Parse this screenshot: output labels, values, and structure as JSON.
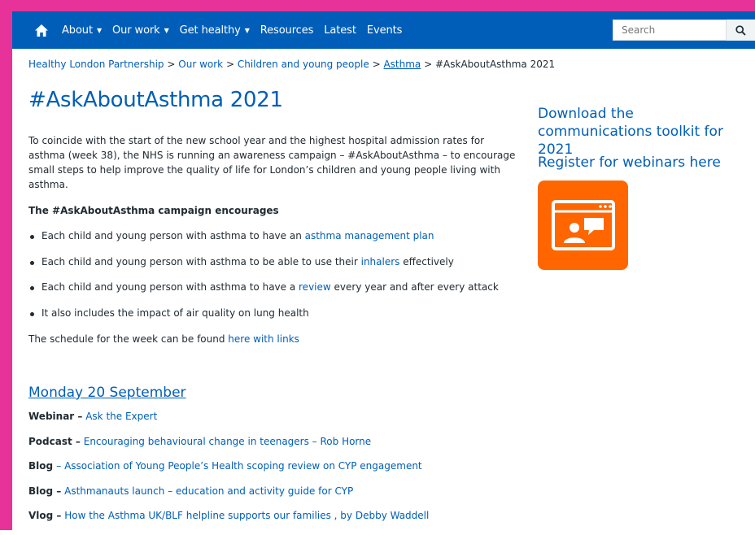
{
  "nav": {
    "items": [
      {
        "label": "About",
        "dropdown": true
      },
      {
        "label": "Our work",
        "dropdown": true
      },
      {
        "label": "Get healthy",
        "dropdown": true
      },
      {
        "label": "Resources",
        "dropdown": false
      },
      {
        "label": "Latest",
        "dropdown": false
      },
      {
        "label": "Events",
        "dropdown": false
      }
    ],
    "search_placeholder": "Search",
    "home_icon": "home-icon",
    "search_icon": "search-icon"
  },
  "breadcrumb": {
    "items": [
      "Healthy London Partnership",
      "Our work",
      "Children and young people",
      "Asthma"
    ],
    "separator": ">",
    "current": "#AskAboutAsthma 2021"
  },
  "page": {
    "title": "#AskAboutAsthma 2021",
    "intro": "To coincide with the start of the new school year and the highest hospital admission rates for asthma (week 38), the NHS is running an awareness campaign – #AskAboutAsthma – to encourage small steps to help improve the quality of life for London’s children and young people living with asthma.",
    "campaign_heading": "The #AskAboutAsthma campaign encourages",
    "bullets": [
      {
        "before": "Each child and young person with asthma to have an ",
        "link": "asthma management plan",
        "after": ""
      },
      {
        "before": "Each child and young person with asthma to be able to use their ",
        "link": "inhalers",
        "after": " effectively"
      },
      {
        "before": "Each child and young person with asthma to have a ",
        "link": "review",
        "after": " every year and after every attack"
      },
      {
        "before": "It also includes the impact of air quality on lung health",
        "link": "",
        "after": ""
      }
    ],
    "schedule_text": "The schedule for the week can be found ",
    "schedule_link": "here with links",
    "day_heading": "Monday 20 September",
    "entries": [
      {
        "type": "Webinar –",
        "link": "Ask the Expert"
      },
      {
        "type": "Podcast –",
        "link": "Encouraging behavioural change in teenagers – Rob Horne"
      },
      {
        "type": "Blog ",
        "link": " – Association of Young People’s Health scoping review on CYP engagement"
      },
      {
        "type": "Blog –",
        "link": "Asthmanauts launch – education and activity guide for CYP"
      },
      {
        "type": "Vlog –",
        "link": "How the Asthma UK/BLF helpline supports our families , by Debby Waddell"
      }
    ]
  },
  "sidebar": {
    "download_link": "Download the communications toolkit for 2021",
    "register_link": "Register for webinars here",
    "tile_icon": "webinar-presenter-icon",
    "tile_color": "#ff6600"
  },
  "colors": {
    "brand_blue": "#005eb8",
    "frame_pink": "#e7329a",
    "text": "#212b32"
  }
}
